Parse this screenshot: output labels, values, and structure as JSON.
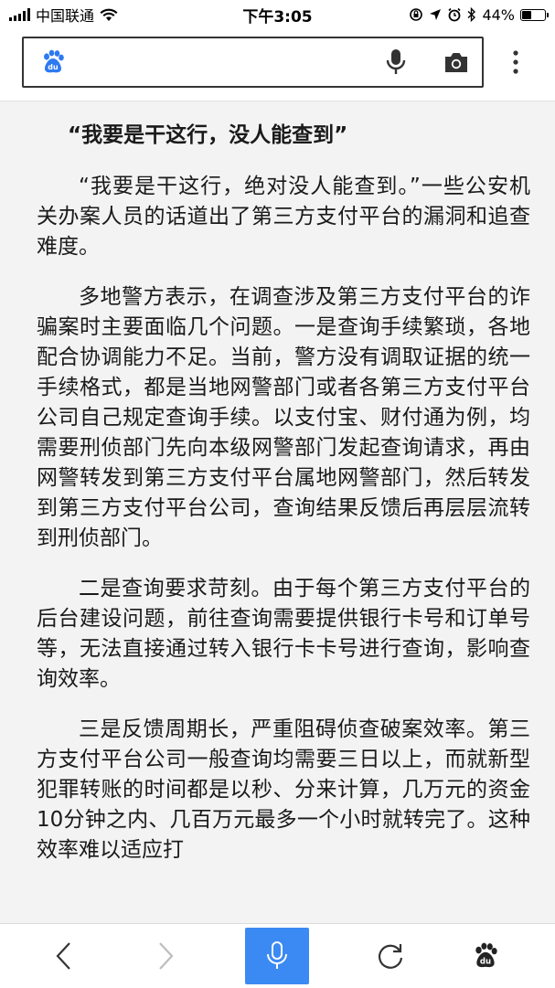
{
  "status_bar": {
    "carrier": "中国联通",
    "time": "下午3:05",
    "battery_text": "44%",
    "battery_level": 0.44
  },
  "header": {
    "search_placeholder": "",
    "logo_text": "du",
    "icons": [
      "baidu-paw-icon",
      "microphone-icon",
      "camera-icon",
      "more-vertical-icon"
    ]
  },
  "article": {
    "headline": "“我要是干这行，没人能查到”",
    "paragraphs": [
      "“我要是干这行，绝对没人能查到。”一些公安机关办案人员的话道出了第三方支付平台的漏洞和追查难度。",
      "多地警方表示，在调查涉及第三方支付平台的诈骗案时主要面临几个问题。一是查询手续繁琐，各地配合协调能力不足。当前，警方没有调取证据的统一手续格式，都是当地网警部门或者各第三方支付平台公司自己规定查询手续。以支付宝、财付通为例，均需要刑侦部门先向本级网警部门发起查询请求，再由网警转发到第三方支付平台属地网警部门，然后转发到第三方支付平台公司，查询结果反馈后再层层流转到刑侦部门。",
      "二是查询要求苛刻。由于每个第三方支付平台的后台建设问题，前往查询需要提供银行卡号和订单号等，无法直接通过转入银行卡卡号进行查询，影响查询效率。",
      "三是反馈周期长，严重阻碍侦查破案效率。第三方支付平台公司一般查询均需要三日以上，而就新型犯罪转账的时间都是以秒、分来计算，几万元的资金10分钟之内、几百万元最多一个小时就转完了。这种效率难以适应打"
    ]
  },
  "bottom_bar": {
    "icons": [
      "back-icon",
      "forward-icon",
      "voice-search-icon",
      "refresh-icon",
      "baidu-home-icon"
    ],
    "voice_color": "#3b8af3",
    "home_logo_text": "du"
  }
}
